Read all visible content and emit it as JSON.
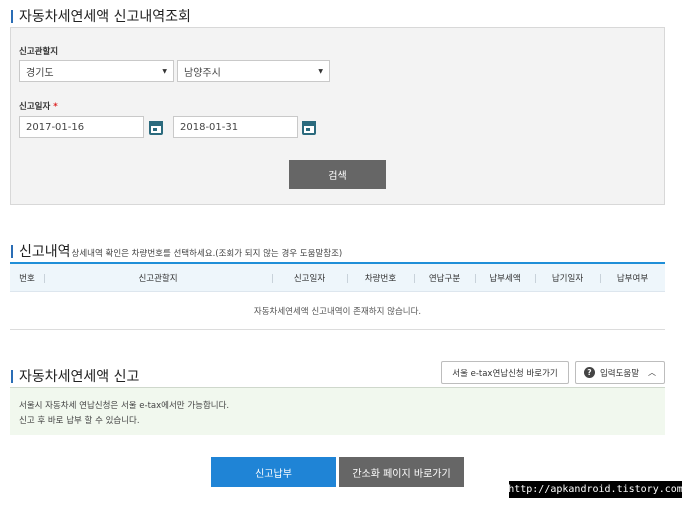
{
  "search_section": {
    "title": "자동차세연세액 신고내역조회",
    "office_label": "신고관할지",
    "province_value": "경기도",
    "city_value": "남양주시",
    "date_label": "신고일자",
    "required_mark": "*",
    "date_from": "2017-01-16",
    "date_to": "2018-01-31",
    "search_button": "검색"
  },
  "history_section": {
    "title": "신고내역",
    "subtitle": "상세내역 확인은 차량번호를 선택하세요.(조회가 되지 않는 경우 도움말참조)",
    "columns": [
      "번호",
      "신고관할지",
      "신고일자",
      "차량번호",
      "연납구분",
      "납부세액",
      "납기일자",
      "납부여부"
    ],
    "empty_message": "자동차세연세액 신고내역이 존재하지 않습니다."
  },
  "report_section": {
    "title": "자동차세연세액 신고",
    "seoul_link": "서울 e-tax연납신청 바로가기",
    "help_button": "입력도움말",
    "notice_lines": [
      "서울시 자동차세 연납신청은 서울 e-tax에서만 가능합니다.",
      "신고 후 바로 납부 할 수 있습니다."
    ]
  },
  "actions": {
    "report_pay": "신고납부",
    "simple_page": "간소화 페이지 바로가기"
  },
  "watermark": "http://apkandroid.tistory.com",
  "colors": {
    "accent_blue": "#1f84d6",
    "table_border": "#1f8fd8",
    "gray_button": "#666666",
    "required": "#d22222"
  }
}
